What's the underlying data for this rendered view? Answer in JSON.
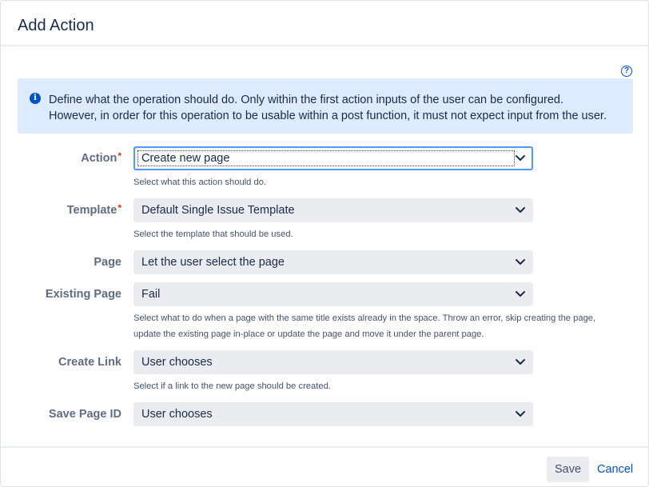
{
  "dialog": {
    "title": "Add Action"
  },
  "help": {
    "glyph": "?"
  },
  "info": {
    "icon_glyph": "i",
    "line1": "Define what the operation should do. Only within the first action inputs of the user can be configured.",
    "line2": "However, in order for this operation to be usable within a post function, it must not expect input from the user."
  },
  "form": {
    "required_mark": "*",
    "action": {
      "label": "Action",
      "value": "Create new page",
      "description": "Select what this action should do."
    },
    "template": {
      "label": "Template",
      "value": "Default Single Issue Template",
      "description": "Select the template that should be used."
    },
    "page": {
      "label": "Page",
      "value": "Let the user select the page"
    },
    "existing_page": {
      "label": "Existing Page",
      "value": "Fail",
      "description_line1": "Select what to do when a page with the same title exists already in the space. Throw an error, skip creating the page,",
      "description_line2": "update the existing page in-place or update the page and move it under the parent page."
    },
    "create_link": {
      "label": "Create Link",
      "value": "User chooses",
      "description": "Select if a link to the new page should be created."
    },
    "save_page_id": {
      "label": "Save Page ID",
      "value": "User chooses"
    }
  },
  "footer": {
    "save_label": "Save",
    "cancel_label": "Cancel"
  },
  "colors": {
    "accent": "#0052cc",
    "info_bg": "#deebff",
    "required": "#de350b",
    "focus": "#4c9aff"
  }
}
